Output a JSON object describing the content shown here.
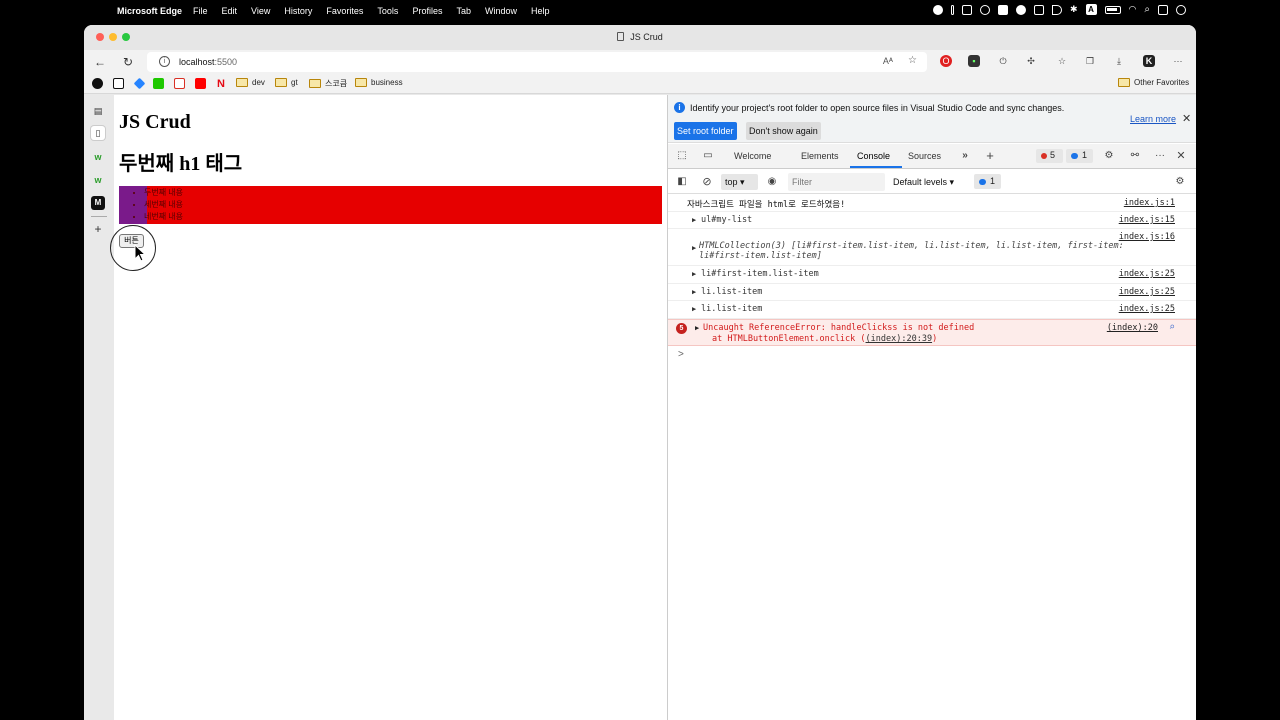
{
  "menubar": {
    "app_name": "Microsoft Edge",
    "menus": [
      "File",
      "Edit",
      "View",
      "History",
      "Favorites",
      "Tools",
      "Profiles",
      "Tab",
      "Window",
      "Help"
    ]
  },
  "window": {
    "title": "JS Crud"
  },
  "toolbar": {
    "url_host": "localhost",
    "url_port": ":5500"
  },
  "bookmarks": {
    "items": [
      "dev",
      "gt",
      "스코큼",
      "business"
    ],
    "other": "Other Favorites"
  },
  "page": {
    "heading1": "JS Crud",
    "heading2": "두번째 h1 태그",
    "list_items": [
      "두번째 내용",
      "세번째 내용",
      "네번째 내용"
    ],
    "button_label": "버튼"
  },
  "devtools": {
    "info_message": "Identify your project's root folder to open source files in Visual Studio Code and sync changes.",
    "set_root_label": "Set root folder",
    "dont_show_label": "Don't show again",
    "learn_more": "Learn more",
    "tabs": [
      "Welcome",
      "Elements",
      "Console",
      "Sources"
    ],
    "active_tab": "Console",
    "error_count": "5",
    "message_count": "1",
    "context": "top",
    "filter_placeholder": "Filter",
    "levels": "Default levels",
    "filter_message_count": "1",
    "console_rows": [
      {
        "text": "자바스크립트 파일을 html로 로드하였음!",
        "source": "index.js:1"
      },
      {
        "text": "ul#my-list",
        "source": "index.js:15"
      },
      {
        "text": "HTMLCollection(3) [li#first-item.list-item, li.list-item, li.list-item, first-item: li#first-item.list-item]",
        "source": "index.js:16"
      },
      {
        "text": "li#first-item.list-item",
        "source": "index.js:25"
      },
      {
        "text": "li.list-item",
        "source": "index.js:25"
      },
      {
        "text": "li.list-item",
        "source": "index.js:25"
      }
    ],
    "error": {
      "count": "5",
      "line1": "Uncaught ReferenceError: handleClickss is not defined",
      "line2_prefix": "at HTMLButtonElement.onclick (",
      "line2_link": "(index):20:39",
      "line2_suffix": ")",
      "source": "(index):20"
    },
    "prompt": ">"
  },
  "colors": {
    "accent": "#1a73e8",
    "page_red": "#e60000",
    "page_purple": "#7a1a8a",
    "error_red": "#d21b1b"
  }
}
